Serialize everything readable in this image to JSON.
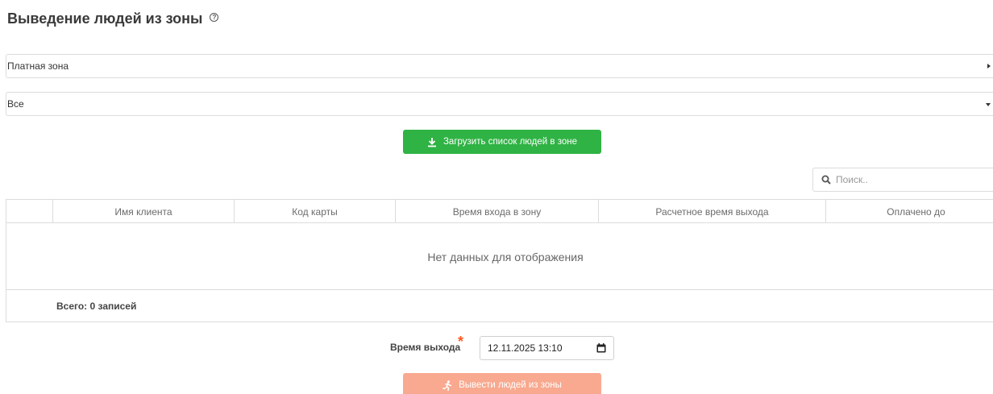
{
  "page": {
    "title": "Выведение людей из зоны"
  },
  "zone_select": {
    "value": "Платная зона"
  },
  "filter_select": {
    "value": "Все"
  },
  "load_button": {
    "label": "Загрузить список людей в зоне",
    "color": "#2fb344",
    "icon": "download-icon"
  },
  "search": {
    "placeholder": "Поиск..",
    "icon": "search-icon"
  },
  "grid": {
    "columns": [
      "",
      "Имя клиента",
      "Код карты",
      "Время входа в зону",
      "Расчетное время выхода",
      "Оплачено до"
    ],
    "empty_text": "Нет данных для отображения",
    "footer": "Всего: 0 записей"
  },
  "exit_time": {
    "label": "Время выхода",
    "required_mark": "*",
    "value": "12.11.2025 13:10",
    "icon": "calendar-icon"
  },
  "exit_button": {
    "label": "Вывести людей из зоны",
    "color": "#f8a98f",
    "icon": "running-person-icon",
    "disabled": true
  }
}
